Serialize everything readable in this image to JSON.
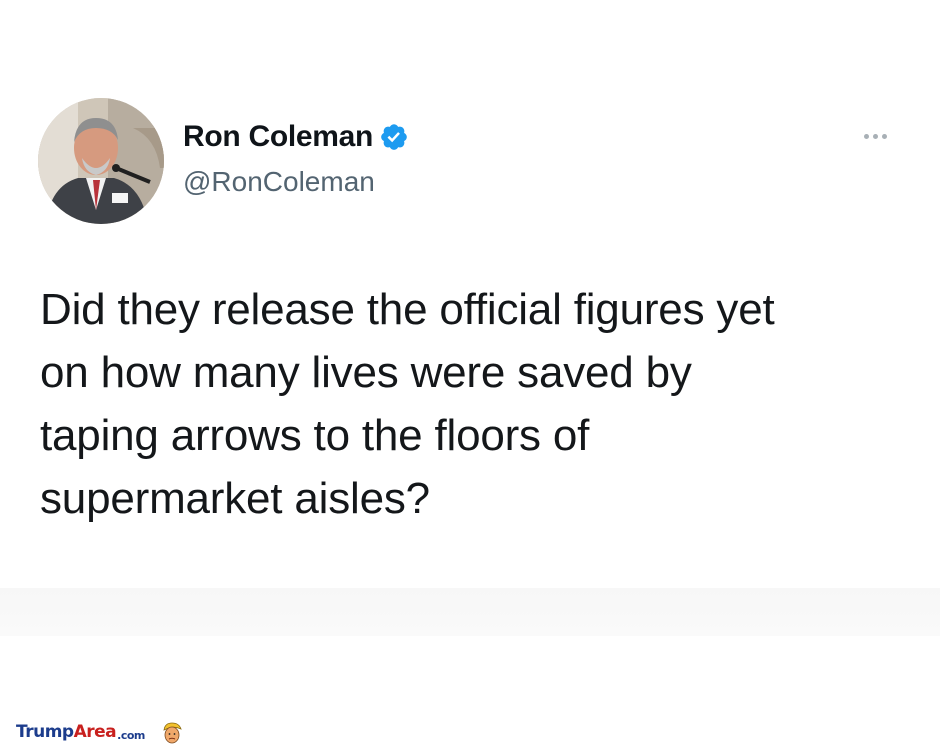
{
  "author": {
    "display_name": "Ron Coleman",
    "handle": "@RonColeman",
    "verified": true,
    "avatar_icon": "user-photo"
  },
  "tweet": {
    "lines": [
      "Did they release the official figures yet",
      "on how many lives were saved by",
      "taping arrows to the floors of",
      "supermarket aisles?"
    ]
  },
  "menu": {
    "icon": "more-options-icon"
  },
  "watermark": {
    "part1": "Trump",
    "part2": "Area",
    "part3": ".com",
    "logo_icon": "trump-face-icon"
  },
  "colors": {
    "verified_blue": "#1d9bf0",
    "handle_gray": "#536471",
    "watermark_blue": "#1c3c8c",
    "watermark_red": "#c8201e"
  }
}
